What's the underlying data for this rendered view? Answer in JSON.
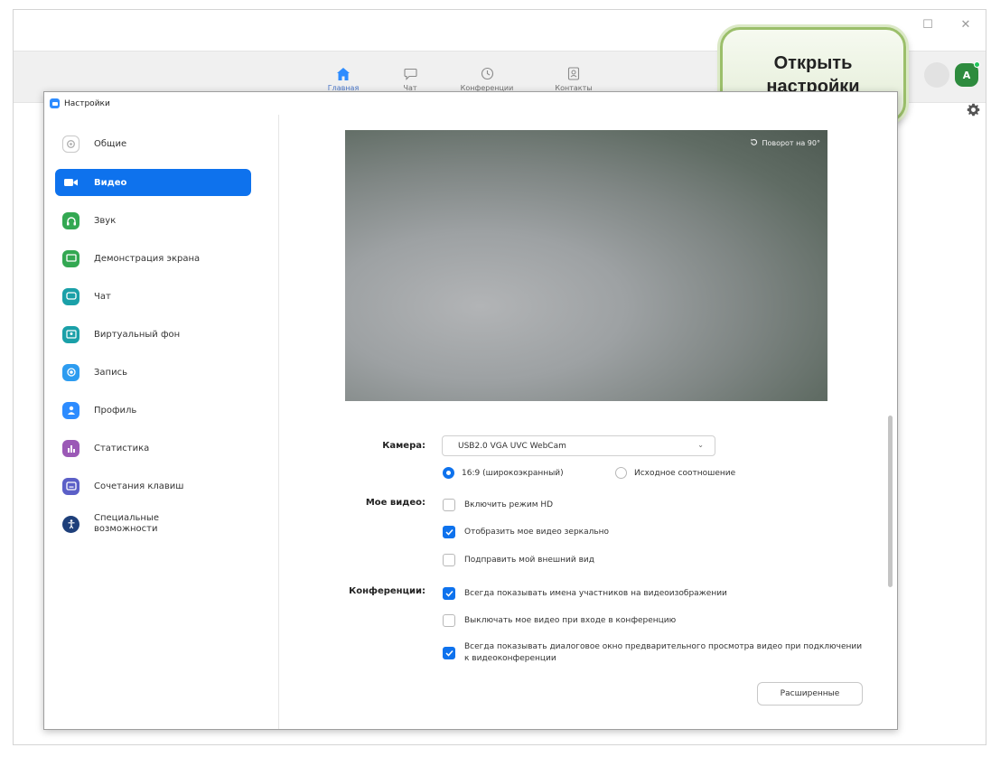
{
  "nav_tabs": [
    {
      "label": "Главная",
      "icon": "home-icon"
    },
    {
      "label": "Чат",
      "icon": "chat-icon"
    },
    {
      "label": "Конференции",
      "icon": "clock-icon"
    },
    {
      "label": "Контакты",
      "icon": "contacts-icon"
    }
  ],
  "user": {
    "avatar_letter": "A"
  },
  "callout": {
    "line1": "Открыть",
    "line2": "настройки"
  },
  "settings": {
    "title": "Настройки",
    "sidebar": [
      {
        "label": "Общие",
        "icon": "gear-icon",
        "color": "#c8c8c8"
      },
      {
        "label": "Видео",
        "icon": "video-camera-icon",
        "color": "#ffffff"
      },
      {
        "label": "Звук",
        "icon": "headphones-icon",
        "color": "#33a852"
      },
      {
        "label": "Демонстрация экрана",
        "icon": "screen-share-icon",
        "color": "#33a852"
      },
      {
        "label": "Чат",
        "icon": "chat-icon",
        "color": "#1aa0a8"
      },
      {
        "label": "Виртуальный фон",
        "icon": "virtual-background-icon",
        "color": "#1aa0a8"
      },
      {
        "label": "Запись",
        "icon": "record-icon",
        "color": "#2d9cf0"
      },
      {
        "label": "Профиль",
        "icon": "profile-icon",
        "color": "#2d8cff"
      },
      {
        "label": "Статистика",
        "icon": "statistics-icon",
        "color": "#9b59b6"
      },
      {
        "label": "Сочетания клавиш",
        "icon": "keyboard-icon",
        "color": "#5b5fc7"
      },
      {
        "label": "Специальные возможности",
        "icon": "accessibility-icon",
        "color": "#1e3f7a"
      }
    ],
    "video": {
      "rotate_label": "Поворот на 90°",
      "camera_label": "Камера:",
      "camera_value": "USB2.0 VGA UVC WebCam",
      "aspect_widescreen": "16:9 (широкоэкранный)",
      "aspect_original": "Исходное соотношение",
      "my_video_label": "Мое видео:",
      "hd": "Включить режим HD",
      "mirror": "Отобразить мое видео зеркально",
      "touch_up": "Подправить мой внешний вид",
      "meetings_label": "Конференции:",
      "show_names": "Всегда показывать имена участников на видеоизображении",
      "turn_off_video": "Выключать мое видео при входе в конференцию",
      "preview_dialog": "Всегда показывать диалоговое окно предварительного просмотра видео при подключении к видеоконференции",
      "advanced_button": "Расширенные"
    }
  },
  "accent_color": "#0e72ed"
}
